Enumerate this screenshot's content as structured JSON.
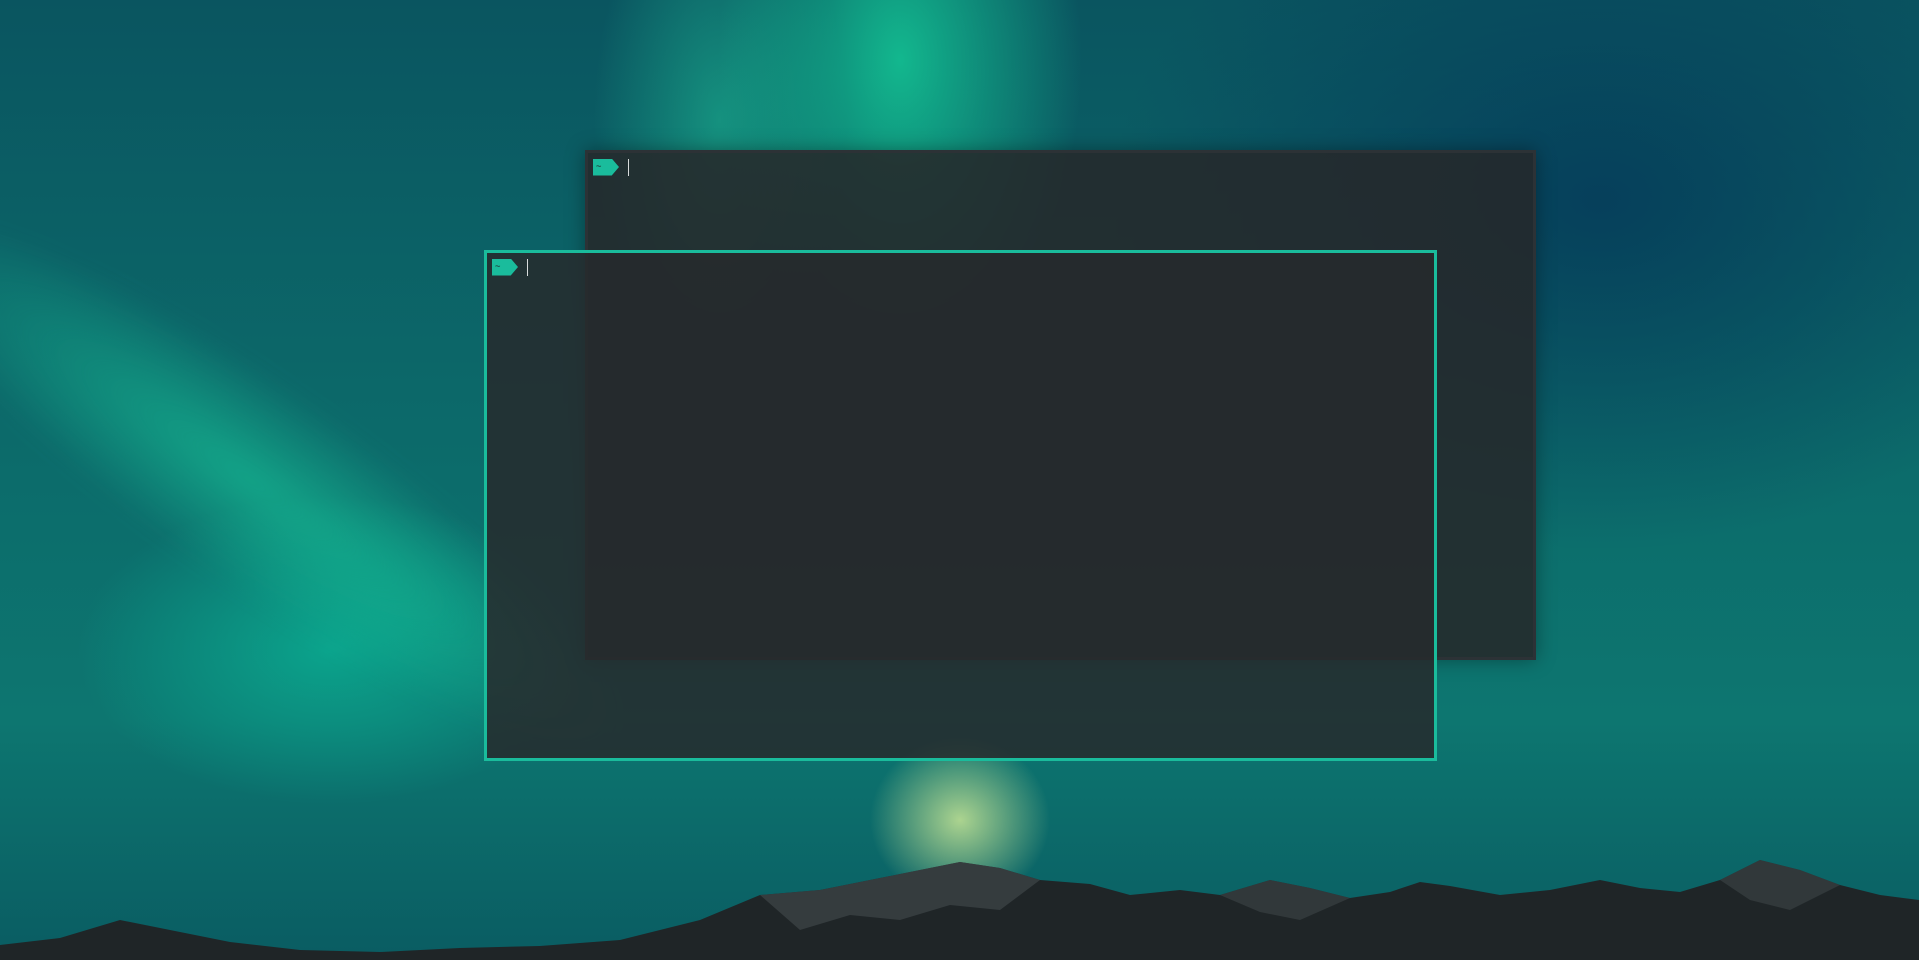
{
  "desktop": {
    "wallpaper": "aurora-over-mountains"
  },
  "terminals": [
    {
      "id": "back",
      "focused": false,
      "prompt": {
        "text": "~",
        "icon": "prompt-arrow-badge"
      },
      "border_color": "#2c3236"
    },
    {
      "id": "front",
      "focused": true,
      "prompt": {
        "text": "~",
        "icon": "prompt-arrow-badge"
      },
      "border_color": "#1abc9c"
    }
  ],
  "colors": {
    "accent": "#1abc9c",
    "terminal_bg": "#262a2c",
    "cursor": "#d8dcdc"
  }
}
